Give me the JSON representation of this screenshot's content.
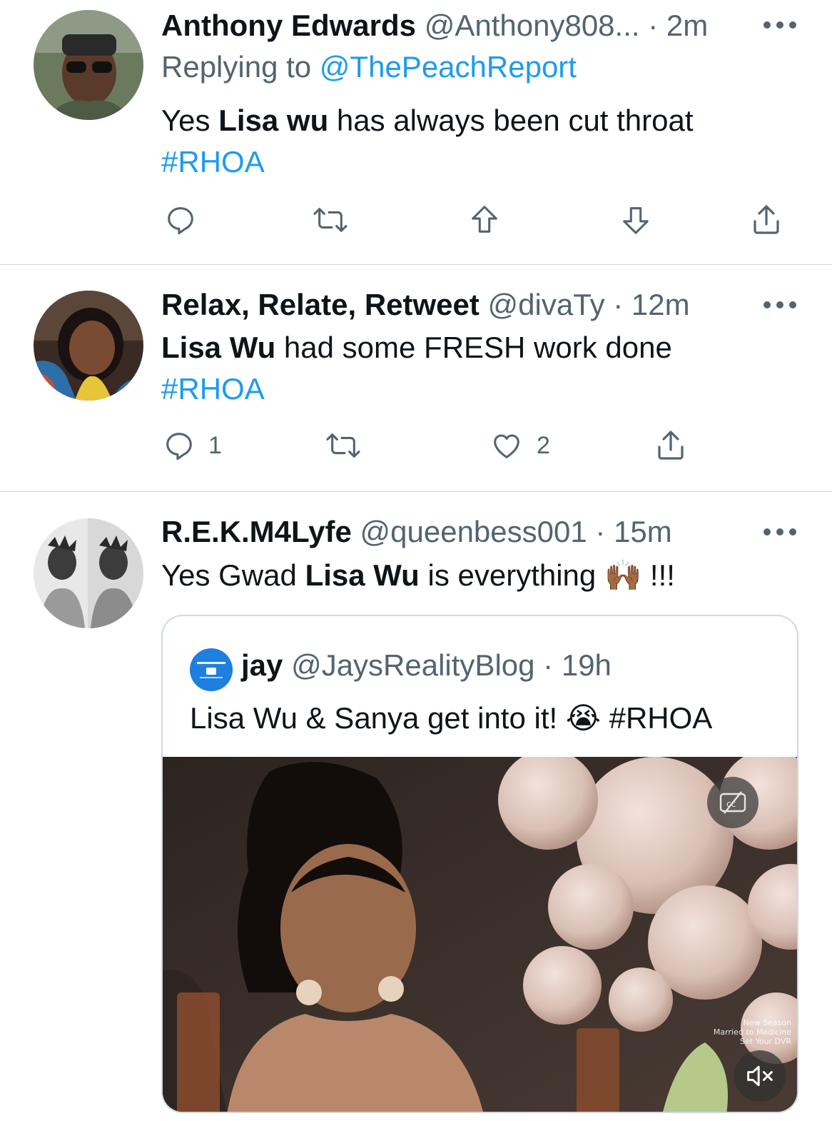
{
  "tweets": [
    {
      "name": "Anthony Edwards",
      "handle": "@Anthony808...",
      "time": "2m",
      "replying_prefix": "Replying to ",
      "replying_to": "@ThePeachReport",
      "text_pre": "Yes ",
      "text_bold": "Lisa wu",
      "text_post": " has always been cut throat",
      "hashtag": "#RHOA",
      "actions": [
        "reply",
        "retweet",
        "upvote",
        "downvote",
        "share"
      ]
    },
    {
      "name": "Relax, Relate, Retweet",
      "handle": "@divaTy",
      "time": "12m",
      "text_bold": "Lisa Wu",
      "text_post": " had some FRESH work done",
      "hashtag": "#RHOA",
      "reply_count": "1",
      "like_count": "2"
    },
    {
      "name": "R.E.K.M4Lyfe",
      "handle": "@queenbess001",
      "time": "15m",
      "text_pre": "Yes Gwad ",
      "text_bold": "Lisa Wu",
      "text_post": " is everything ",
      "emoji": "🙌🏾",
      "text_end": " !!!",
      "quote": {
        "name": "jay",
        "handle": "@JaysRealityBlog",
        "time": "19h",
        "text": "Lisa Wu & Sanya get into it! ",
        "emoji": "😭",
        "hashtag": " #RHOA",
        "video_overlay": [
          "New Season",
          "Married to Medicine",
          "Set Your DVR"
        ]
      }
    }
  ],
  "separator": "·",
  "icons": {
    "reply": "reply-icon",
    "retweet": "retweet-icon",
    "upvote": "upvote-icon",
    "downvote": "downvote-icon",
    "like": "heart-icon",
    "share": "share-icon",
    "more": "more-icon",
    "captions": "captions-off-icon",
    "mute": "muted-icon"
  },
  "colors": {
    "link": "#1d9bf0",
    "secondary": "#536471",
    "text": "#0f1419",
    "border": "#cfd9de"
  }
}
